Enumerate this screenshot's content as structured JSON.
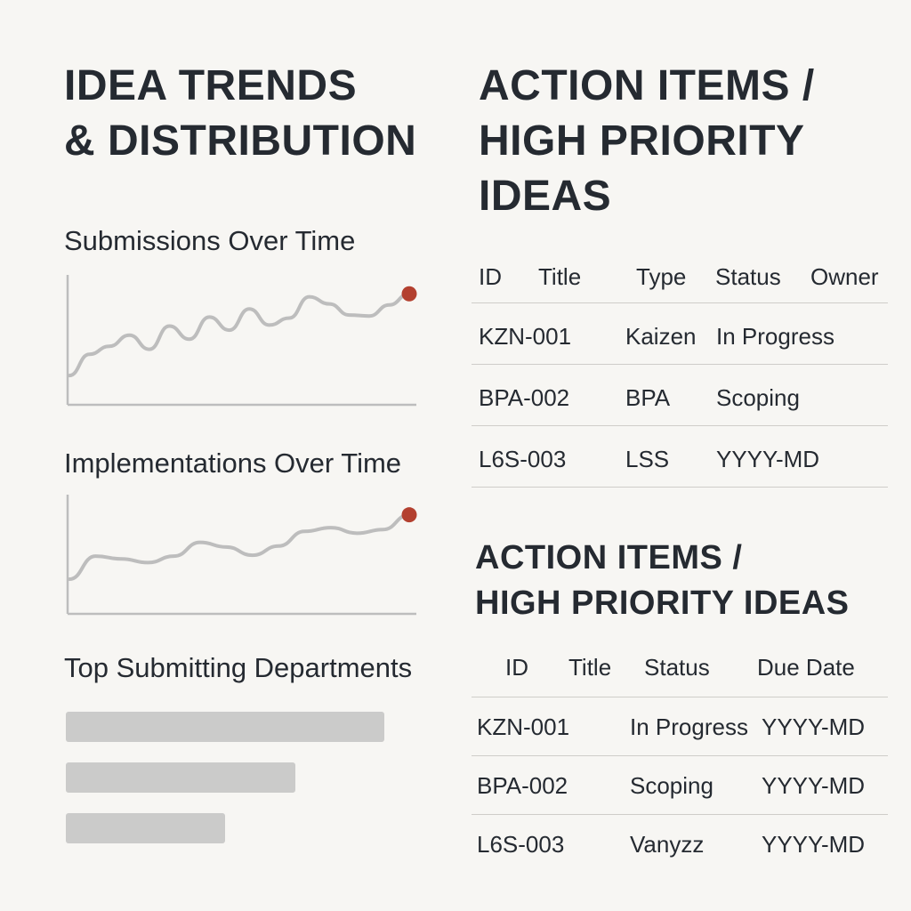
{
  "left": {
    "title_lines": [
      "IDEA TRENDS",
      "& DISTRIBUTION"
    ],
    "submissions_title": "Submissions Over Time",
    "implementations_title": "Implementations Over Time",
    "departments_title": "Top Submitting Departments"
  },
  "right": {
    "title1_lines": [
      "ACTION ITEMS /",
      "HIGH PRIORITY",
      "IDEAS"
    ],
    "table1": {
      "headers": [
        "ID",
        "Title",
        "Type",
        "Status",
        "Owner"
      ],
      "rows": [
        {
          "id": "KZN-001",
          "type": "Kaizen",
          "status": "In Progress"
        },
        {
          "id": "BPA-002",
          "type": "BPA",
          "status": "Scoping"
        },
        {
          "id": "L6S-003",
          "type": "LSS",
          "status": "YYYY-MD"
        }
      ]
    },
    "title2_lines": [
      "ACTION ITEMS /",
      "HIGH PRIORITY IDEAS"
    ],
    "table2": {
      "headers": [
        "ID",
        "Title",
        "Status",
        "Due Date"
      ],
      "rows": [
        {
          "id": "KZN-001",
          "status": "In Progress",
          "due": "YYYY-MD"
        },
        {
          "id": "BPA-002",
          "status": "Scoping",
          "due": "YYYY-MD"
        },
        {
          "id": "L6S-003",
          "status": "Vanyzz",
          "due": "YYYY-MD"
        }
      ]
    }
  },
  "colors": {
    "background": "#f7f6f3",
    "text": "#252a31",
    "line": "#bdbdbd",
    "axis": "#bdbdbd",
    "marker": "#b3402f",
    "bar": "#cbcbca"
  },
  "chart_data": [
    {
      "type": "line",
      "title": "Submissions Over Time",
      "x": [
        0,
        1,
        2,
        3,
        4,
        5,
        6,
        7,
        8,
        9,
        10,
        11,
        12,
        13,
        14,
        15,
        16,
        17
      ],
      "series": [
        {
          "values": [
            22,
            43,
            51,
            62,
            48,
            71,
            58,
            80,
            67,
            88,
            72,
            79,
            100,
            93,
            82,
            81,
            92,
            103
          ]
        }
      ],
      "ylim": [
        0,
        120
      ],
      "grid": false,
      "highlight": "last point"
    },
    {
      "type": "line",
      "title": "Implementations Over Time",
      "x": [
        0,
        1,
        2,
        3,
        4,
        5,
        6,
        7,
        8,
        9,
        10,
        11,
        12,
        13
      ],
      "series": [
        {
          "values": [
            30,
            55,
            52,
            48,
            55,
            70,
            65,
            56,
            66,
            82,
            86,
            80,
            84,
            100
          ]
        }
      ],
      "ylim": [
        0,
        120
      ],
      "grid": false,
      "highlight": "last point"
    },
    {
      "type": "bar",
      "orientation": "horizontal",
      "title": "Top Submitting Departments",
      "values": [
        100,
        72,
        50
      ]
    }
  ]
}
